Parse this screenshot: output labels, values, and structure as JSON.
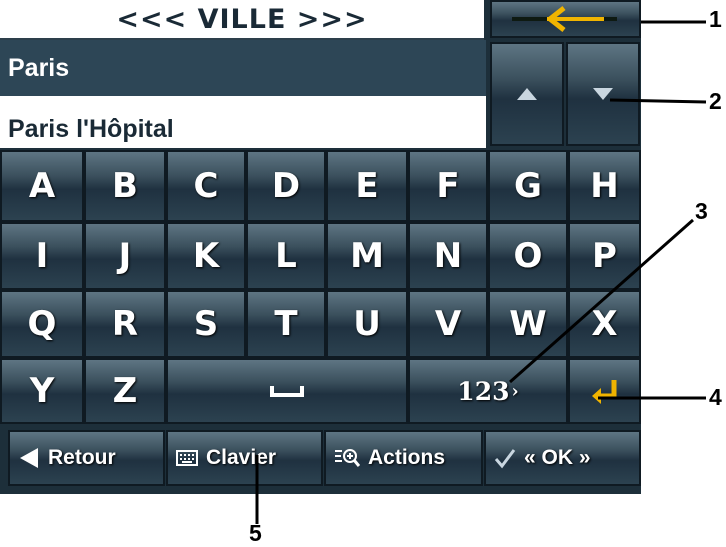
{
  "header": {
    "title": "<<< VILLE >>>"
  },
  "list": {
    "items": [
      "Paris",
      "Paris l'Hôpital"
    ],
    "selected_index": 0
  },
  "keyboard": {
    "rows": [
      [
        "A",
        "B",
        "C",
        "D",
        "E",
        "F",
        "G",
        "H"
      ],
      [
        "I",
        "J",
        "K",
        "L",
        "M",
        "N",
        "O",
        "P"
      ],
      [
        "Q",
        "R",
        "S",
        "T",
        "U",
        "V",
        "W",
        "X"
      ],
      [
        "Y",
        "Z"
      ]
    ],
    "space_label": "⎵",
    "numeric_label": "123",
    "numeric_arrow": "›",
    "enter_glyph": "↵"
  },
  "toolbar": {
    "back_label": "Retour",
    "keyboard_label": "Clavier",
    "actions_label": "Actions",
    "ok_label": "« OK »"
  },
  "callouts": [
    "1",
    "2",
    "3",
    "4",
    "5"
  ],
  "colors": {
    "accent": "#f0b400",
    "key_dark": "#1f3140",
    "selection": "#2d4656"
  }
}
